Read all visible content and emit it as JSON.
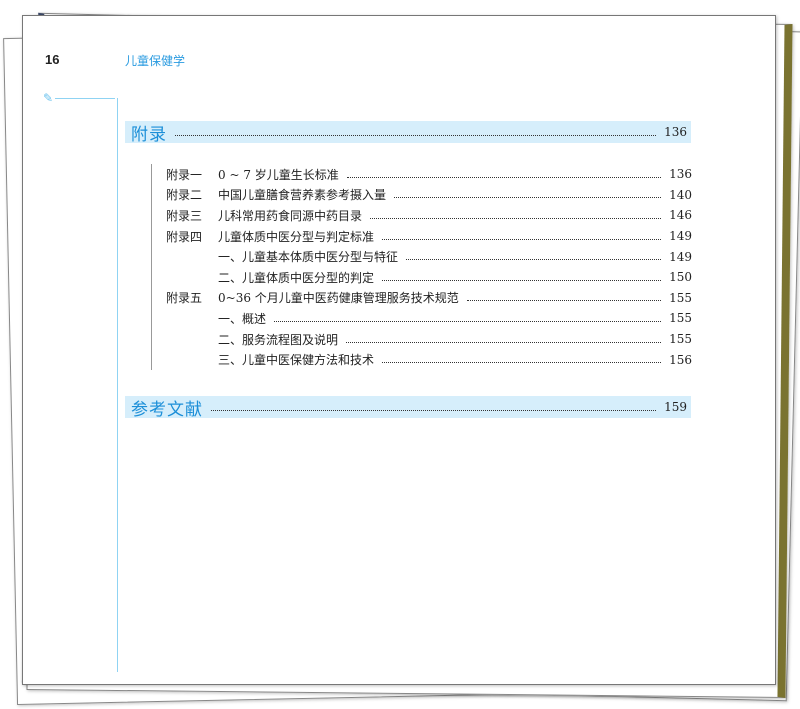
{
  "header": {
    "page_number": "16",
    "running_title": "儿童保健学"
  },
  "sections": [
    {
      "title": "附录",
      "page": "136"
    },
    {
      "title": "参考文献",
      "page": "159"
    }
  ],
  "entries": [
    {
      "label": "附录一",
      "title": "0 ~ 7 岁儿童生长标准",
      "page": "136"
    },
    {
      "label": "附录二",
      "title": "中国儿童膳食营养素参考摄入量",
      "page": "140"
    },
    {
      "label": "附录三",
      "title": "儿科常用药食同源中药目录",
      "page": "146"
    },
    {
      "label": "附录四",
      "title": "儿童体质中医分型与判定标准",
      "page": "149"
    },
    {
      "label": "",
      "title": "一、儿童基本体质中医分型与特征",
      "page": "149"
    },
    {
      "label": "",
      "title": "二、儿童体质中医分型的判定",
      "page": "150"
    },
    {
      "label": "附录五",
      "title": "0~36 个月儿童中医药健康管理服务技术规范",
      "page": "155"
    },
    {
      "label": "",
      "title": "一、概述",
      "page": "155"
    },
    {
      "label": "",
      "title": "二、服务流程图及说明",
      "page": "155"
    },
    {
      "label": "",
      "title": "三、儿童中医保健方法和技术",
      "page": "156"
    }
  ]
}
